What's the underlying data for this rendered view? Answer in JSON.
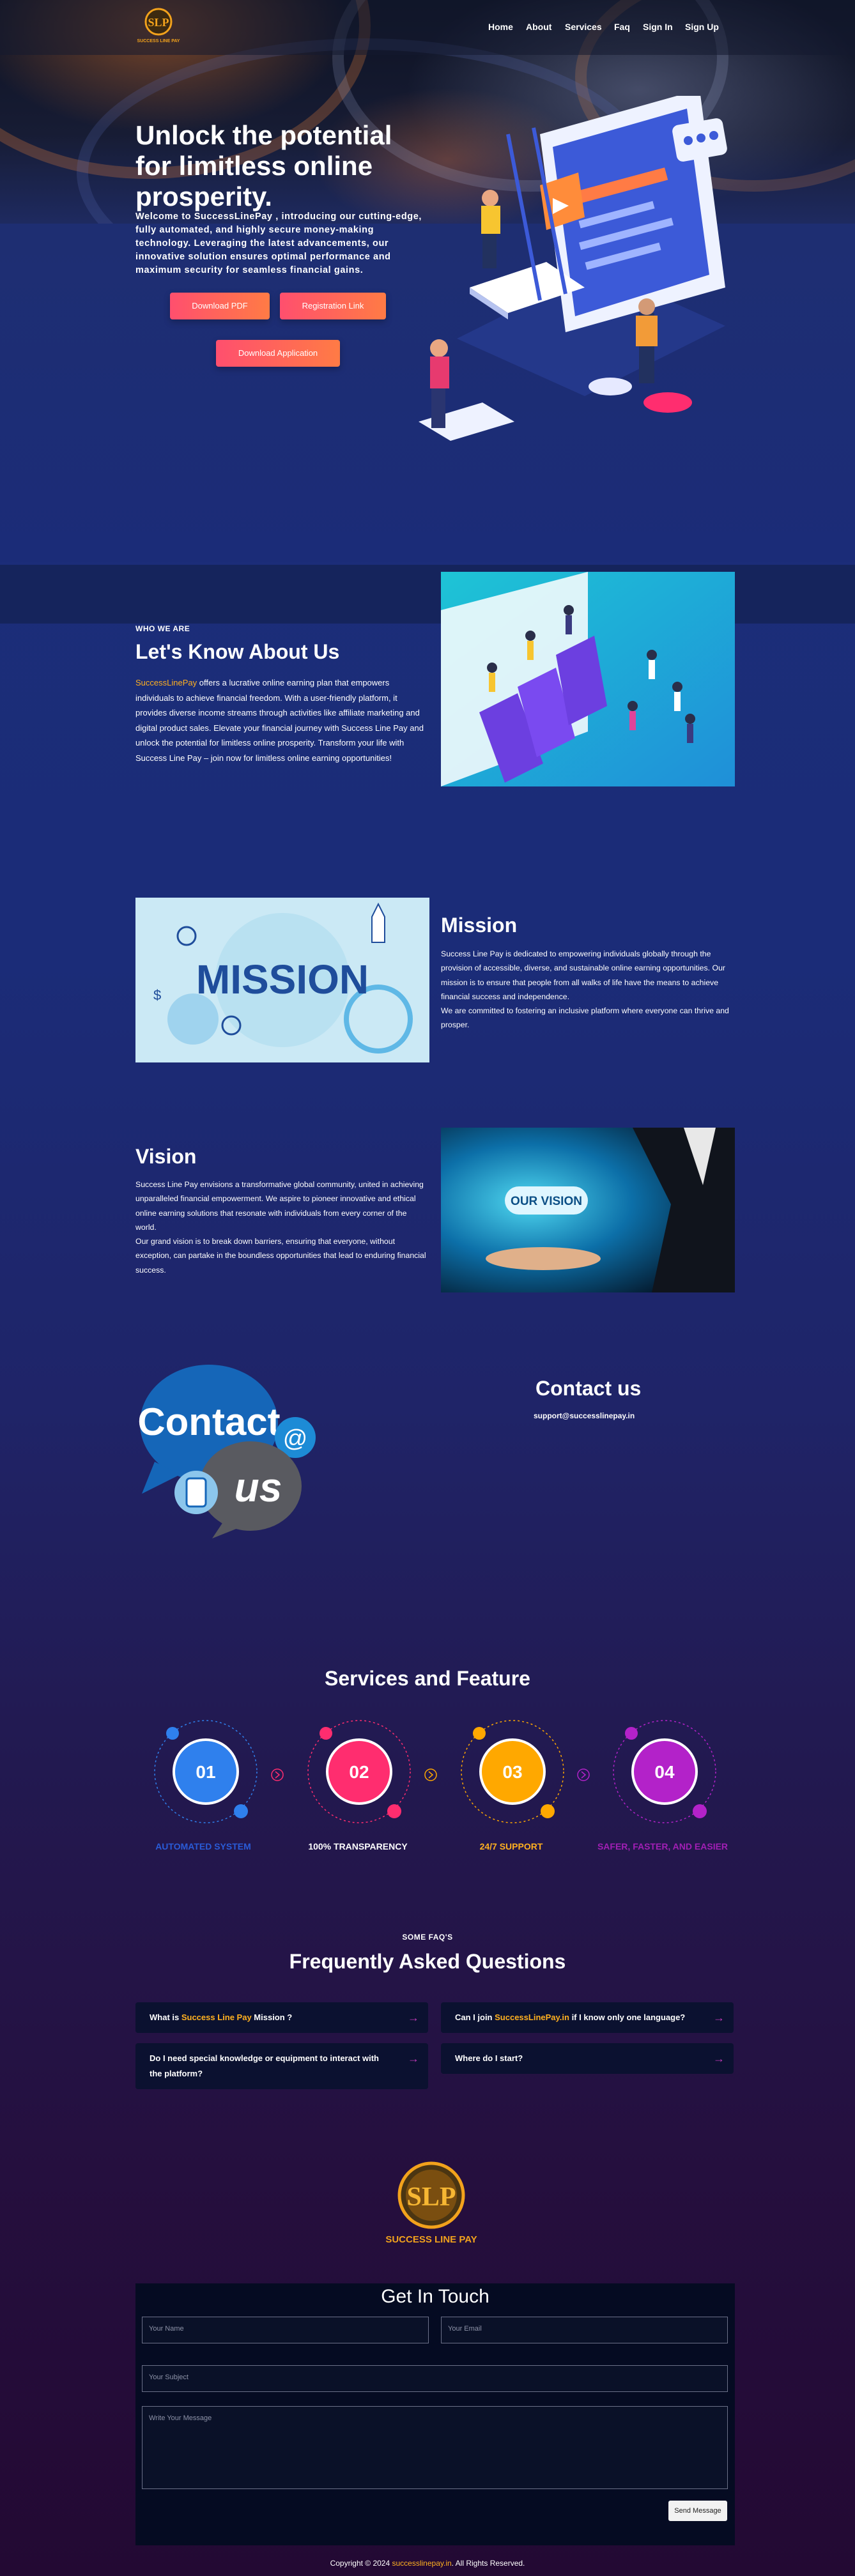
{
  "header": {
    "brand_text": "SUCCESS LINE PAY",
    "nav": [
      "Home",
      "About",
      "Services",
      "Faq",
      "Sign In",
      "Sign Up"
    ]
  },
  "hero": {
    "title": "Unlock the potential for limitless online prosperity.",
    "description": "Welcome to SuccessLinePay , introducing our cutting-edge, fully automated, and highly secure money-making technology. Leveraging the latest advancements, our innovative solution ensures optimal performance and maximum security for seamless financial gains.",
    "buttons": [
      "Download PDF",
      "Registration Link",
      "Download Application"
    ]
  },
  "about": {
    "eyebrow": "WHO WE ARE",
    "title": "Let's Know About Us",
    "brand": "SuccessLinePay",
    "text": " offers a lucrative online earning plan that empowers individuals to achieve financial freedom. With a user-friendly platform, it provides diverse income streams through activities like affiliate marketing and digital product sales. Elevate your financial journey with Success Line Pay and unlock the potential for limitless online prosperity. Transform your life with Success Line Pay – join now for limitless online earning opportunities!"
  },
  "mission": {
    "title": "Mission",
    "image_word": "MISSION",
    "p1": "Success Line Pay is dedicated to empowering individuals globally through the provision of accessible, diverse, and sustainable online earning opportunities. Our mission is to ensure that people from all walks of life have the means to achieve financial success and independence.",
    "p2": "We are committed to fostering an inclusive platform where everyone can thrive and prosper."
  },
  "vision": {
    "title": "Vision",
    "image_word": "OUR VISION",
    "p1": "Success Line Pay envisions a transformative global community, united in achieving unparalleled financial empowerment. We aspire to pioneer innovative and ethical online earning solutions that resonate with individuals from every corner of the world.",
    "p2": "Our grand vision is to break down barriers, ensuring that everyone, without exception, can partake in the boundless opportunities that lead to enduring financial success."
  },
  "contact": {
    "image_word_1": "Contact",
    "image_word_2": "us",
    "title": "Contact us",
    "email": "support@successlinepay.in"
  },
  "services": {
    "title": "Services and Feature",
    "items": [
      {
        "num": "01",
        "label": "AUTOMATED SYSTEM",
        "color": "#2a5bd7"
      },
      {
        "num": "02",
        "label": "100% TRANSPARENCY",
        "color": "#ffffff"
      },
      {
        "num": "03",
        "label": "24/7 SUPPORT",
        "color": "#ffb020"
      },
      {
        "num": "04",
        "label": "SAFER, FASTER, AND EASIER",
        "color": "#a21fb5"
      }
    ],
    "colors": [
      "#2f80ed",
      "#ff2d6f",
      "#ffa800",
      "#b322c9"
    ]
  },
  "faq": {
    "eyebrow": "SOME FAQ'S",
    "title": "Frequently Asked Questions",
    "items": [
      {
        "pre": "What is ",
        "brand": "Success Line Pay",
        "post": " Mission ?"
      },
      {
        "pre": "Can I join ",
        "brand": "SuccessLinePay.in",
        "post": " if I know only one language?"
      },
      {
        "pre": "Do I need special knowledge or equipment to interact with the platform?",
        "brand": "",
        "post": ""
      },
      {
        "pre": "Where do I start?",
        "brand": "",
        "post": ""
      }
    ]
  },
  "logo": {
    "initials": "SLP",
    "text": "SUCCESS LINE PAY"
  },
  "form": {
    "title": "Get In Touch",
    "name_placeholder": "Your Name",
    "email_placeholder": "Your Email",
    "subject_placeholder": "Your Subject",
    "message_placeholder": "Write Your Message",
    "send_label": "Send Message"
  },
  "footer": {
    "pre": "Copyright © 2024 ",
    "link": "successlinepay.in",
    "post": ". All Rights Reserved."
  }
}
